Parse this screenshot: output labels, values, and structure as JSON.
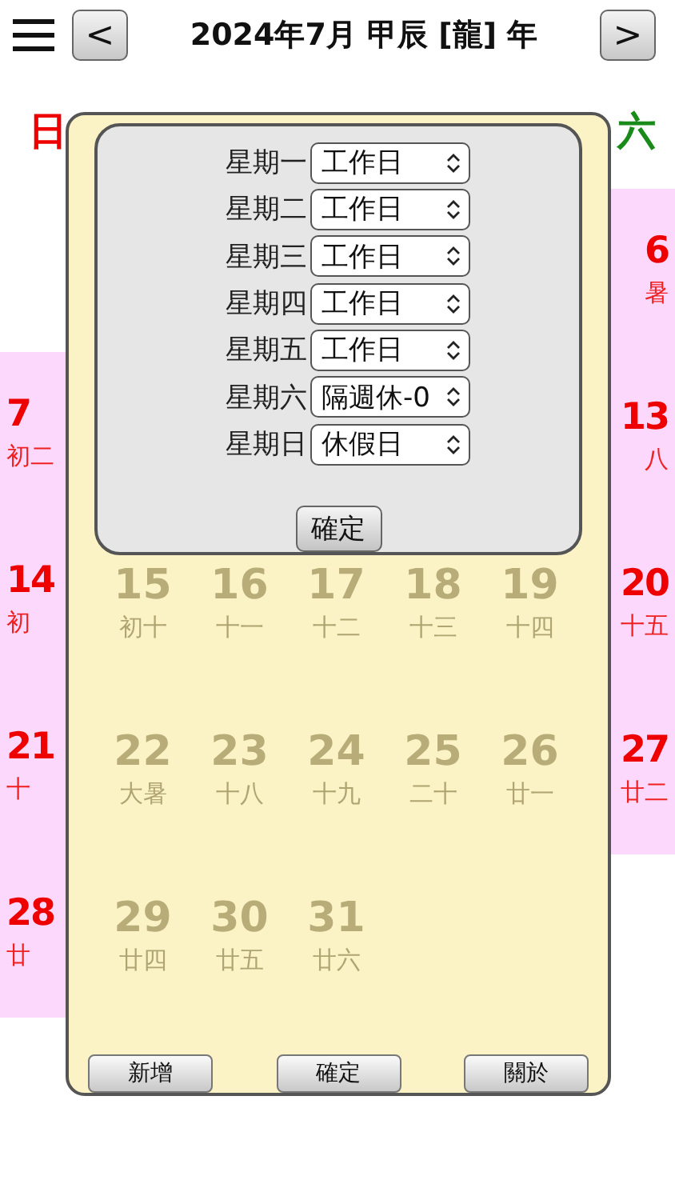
{
  "header": {
    "title": "2024年7月 甲辰 [龍] 年",
    "prev": "<",
    "next": ">"
  },
  "weekday_headers": [
    {
      "label": "日",
      "kind": "sunday"
    },
    {
      "label": "六",
      "kind": "saturday"
    }
  ],
  "sunday_column": [
    {
      "day": "7",
      "lunar": "初二"
    },
    {
      "day": "14",
      "lunar": "初"
    },
    {
      "day": "21",
      "lunar": "十"
    },
    {
      "day": "28",
      "lunar": "廿"
    }
  ],
  "saturday_column": [
    {
      "day": "6",
      "lunar": "暑"
    },
    {
      "day": "13",
      "lunar": "八"
    },
    {
      "day": "20",
      "lunar": "十五"
    },
    {
      "day": "27",
      "lunar": "廿二"
    }
  ],
  "faded_days": [
    [
      {
        "day": "15",
        "lunar": "初十"
      },
      {
        "day": "16",
        "lunar": "十一"
      },
      {
        "day": "17",
        "lunar": "十二"
      },
      {
        "day": "18",
        "lunar": "十三"
      },
      {
        "day": "19",
        "lunar": "十四"
      }
    ],
    [
      {
        "day": "22",
        "lunar": "大暑"
      },
      {
        "day": "23",
        "lunar": "十八"
      },
      {
        "day": "24",
        "lunar": "十九"
      },
      {
        "day": "25",
        "lunar": "二十"
      },
      {
        "day": "26",
        "lunar": "廿一"
      }
    ],
    [
      {
        "day": "29",
        "lunar": "廿四"
      },
      {
        "day": "30",
        "lunar": "廿五"
      },
      {
        "day": "31",
        "lunar": "廿六"
      }
    ]
  ],
  "settings_dialog": {
    "rows": [
      {
        "label": "星期一",
        "value": "工作日"
      },
      {
        "label": "星期二",
        "value": "工作日"
      },
      {
        "label": "星期三",
        "value": "工作日"
      },
      {
        "label": "星期四",
        "value": "工作日"
      },
      {
        "label": "星期五",
        "value": "工作日"
      },
      {
        "label": "星期六",
        "value": "隔週休-0"
      },
      {
        "label": "星期日",
        "value": "休假日"
      }
    ],
    "confirm": "確定"
  },
  "buttons": [
    "新增",
    "確定",
    "關於"
  ]
}
